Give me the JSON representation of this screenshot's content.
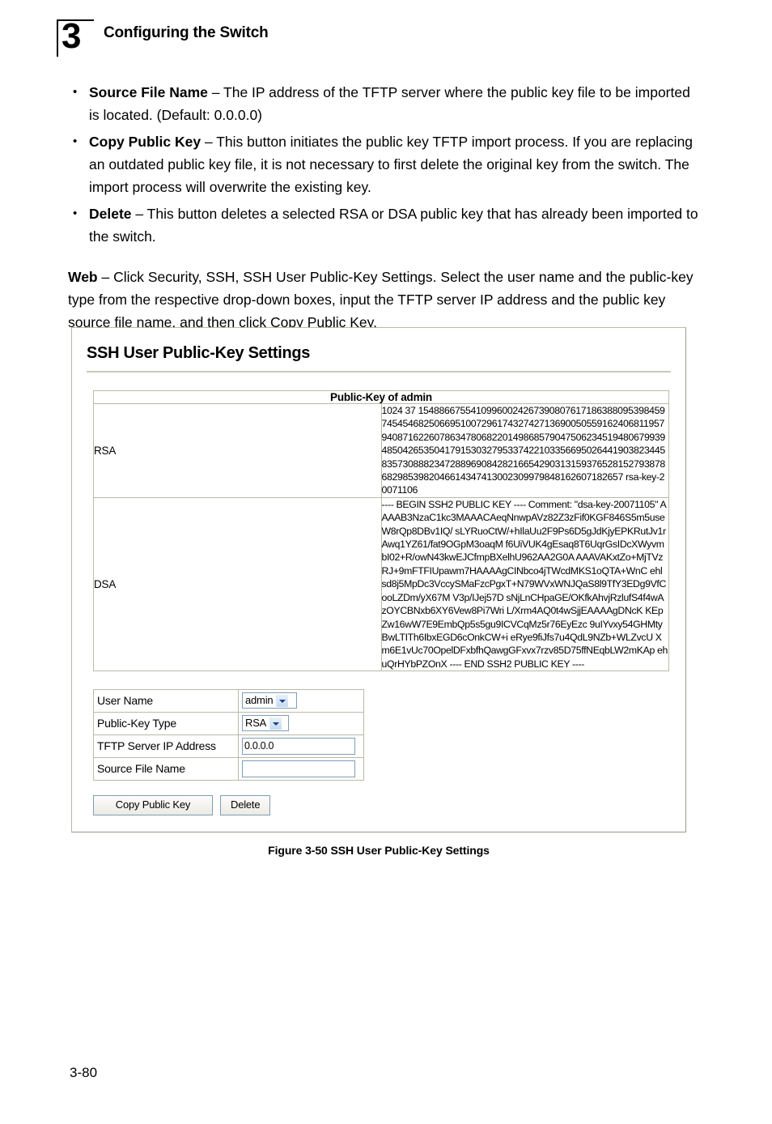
{
  "header": {
    "chapter_number": "3",
    "title": "Configuring the Switch"
  },
  "bullets": [
    {
      "term": "Source File Name",
      "text": " – The IP address of the TFTP server where the public key file to be imported is located. (Default: 0.0.0.0)"
    },
    {
      "term": "Copy Public Key",
      "text": " – This button initiates the public key TFTP import process. If you are replacing an outdated public key file, it is not necessary to first delete the original key from the switch. The import process will overwrite the existing key."
    },
    {
      "term": "Delete",
      "text": " – This button deletes a selected RSA or DSA public key that has already been imported to the switch."
    }
  ],
  "web_paragraph": {
    "term": "Web",
    "text": " – Click Security, SSH, SSH User Public-Key Settings. Select the user name and the public-key type from the respective drop-down boxes, input the TFTP server IP address and the public key source file name, and then click Copy Public Key."
  },
  "panel": {
    "title": "SSH User Public-Key Settings",
    "key_table": {
      "header": "Public-Key of admin",
      "rows": [
        {
          "label": "RSA",
          "value": "1024 37 154886675541099600242673908076171863880953984597454546825066951007296174327427136900505591624068119579408716226078634780682201498685790475062345194806799394850426535041791530327953374221033566950264419038234458357308882347288969084282166542903131593765281527938786829853982046614347413002309979848162607182657 rsa-key-20071106"
        },
        {
          "label": "DSA",
          "value": "---- BEGIN SSH2 PUBLIC KEY ---- Comment: \"dsa-key-20071105\" AAAAB3NzaC1kc3MAAACAeqNnwpAVz82Z3zFif0KGF846S5m5useW8rQp8DBv1IQ/ sLYRuoCtW/+hIlaUu2F9Ps6D5gJdKjyEPKRutJv1rAwq1YZ61/fat9OGpM3oaqM f6UiVUK4gEsaq8T6UqrGsIDcXWyvmbI02+R/owN43kwEJCfmpBXelhU962AA2G0A AAAVAKxtZo+MjTVzRJ+9mFTFIUpawm7HAAAAgCINbco4jTWcdMKS1oQTA+WnC ehl sd8j5MpDc3VccySMaFzcPgxT+N79WVxWNJQaS8l9TfY3EDg9VfCooLZDm/yX67M V3p/IJej57D sNjLnCHpaGE/OKfkAhvjRzlufS4f4wAzOYCBNxb6XY6Vew8Pi7Wri L/Xrm4AQ0t4wSjjEAAAAgDNcK KEpZw16wW7E9EmbQp5s5gu9ICVCqMz5r76EyEzc 9uIYvxy54GHMtyBwLTITh6IbxEGD6cOnkCW+i eRye9fiJfs7u4QdL9NZb+WLZvcU Xm6E1vUc70OpelDFxbfhQawgGFxvx7rzv85D75ffNEqbLW2mKAp ehuQrHYbPZOnX ---- END SSH2 PUBLIC KEY ----"
        }
      ]
    },
    "form": {
      "fields": [
        {
          "label": "User Name",
          "control": "select",
          "value": "admin"
        },
        {
          "label": "Public-Key Type",
          "control": "select",
          "value": "RSA"
        },
        {
          "label": "TFTP Server IP Address",
          "control": "text",
          "value": "0.0.0.0"
        },
        {
          "label": "Source File Name",
          "control": "text",
          "value": ""
        }
      ]
    },
    "buttons": {
      "copy_label": "Copy Public Key",
      "delete_label": "Delete"
    }
  },
  "figure_caption": "Figure 3-50  SSH User Public-Key Settings",
  "page_number": "3-80"
}
